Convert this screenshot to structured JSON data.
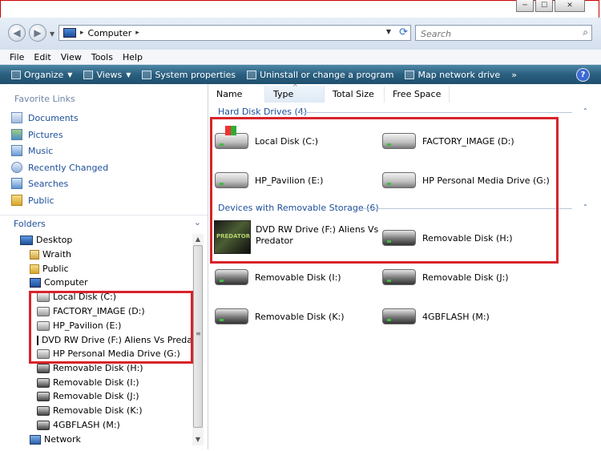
{
  "window": {
    "buttons": [
      "─",
      "☐",
      "✕"
    ]
  },
  "nav": {
    "back": "◀",
    "forward": "▶",
    "address": "Computer",
    "search_placeholder": "Search"
  },
  "menu": [
    "File",
    "Edit",
    "View",
    "Tools",
    "Help"
  ],
  "toolbar": {
    "organize": "Organize",
    "views": "Views",
    "system_properties": "System properties",
    "uninstall": "Uninstall or change a program",
    "map_drive": "Map network drive",
    "more": "»",
    "help": "?"
  },
  "favorites": {
    "heading": "Favorite Links",
    "items": [
      "Documents",
      "Pictures",
      "Music",
      "Recently Changed",
      "Searches",
      "Public"
    ]
  },
  "folders": {
    "heading": "Folders",
    "tree": [
      "Desktop",
      "Wraith",
      "Public",
      "Computer",
      "Local Disk (C:)",
      "FACTORY_IMAGE (D:)",
      "HP_Pavilion (E:)",
      "DVD RW Drive (F:) Aliens Vs Predator",
      "HP Personal Media Drive (G:)",
      "Removable Disk (H:)",
      "Removable Disk (I:)",
      "Removable Disk (J:)",
      "Removable Disk (K:)",
      "4GBFLASH (M:)",
      "Network"
    ]
  },
  "columns": [
    "Name",
    "Type",
    "Total Size",
    "Free Space"
  ],
  "groups": {
    "hdd": "Hard Disk Drives (4)",
    "removable": "Devices with Removable Storage (6)"
  },
  "drives": {
    "c": "Local Disk (C:)",
    "d": "FACTORY_IMAGE (D:)",
    "e": "HP_Pavilion (E:)",
    "g": "HP Personal Media Drive (G:)",
    "f_line1": "DVD RW Drive (F:) Aliens Vs",
    "f_line2": "Predator",
    "h": "Removable Disk (H:)",
    "i": "Removable Disk (I:)",
    "j": "Removable Disk (J:)",
    "k": "Removable Disk (K:)",
    "m": "4GBFLASH (M:)"
  }
}
